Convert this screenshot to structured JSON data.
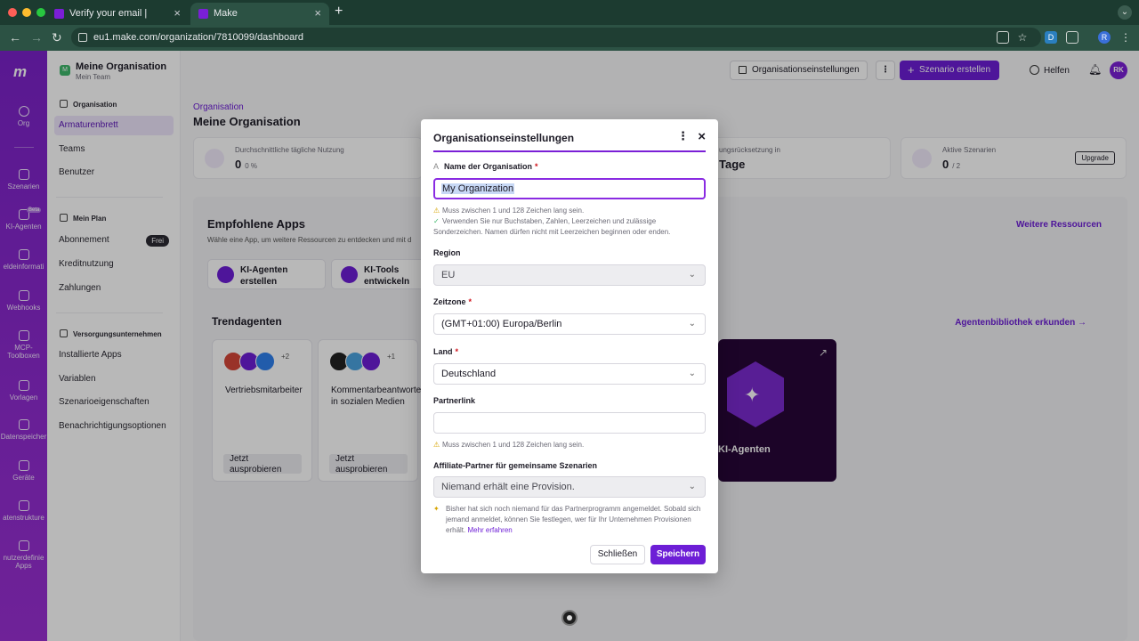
{
  "browser": {
    "tabs": [
      {
        "title": "Verify your email |"
      },
      {
        "title": "Make"
      }
    ],
    "url": "eu1.make.com/organization/7810099/dashboard",
    "ext_labels": [
      "D",
      "R"
    ]
  },
  "rail": {
    "logo": "m",
    "items": [
      "Org",
      "Szenarien",
      "KI-Agenten",
      "eldeinformati",
      "Webhooks",
      "MCP-Toolboxen",
      "Vorlagen",
      "Datenspeicher",
      "Geräte",
      "atenstrukture",
      "nutzerdefinie Apps"
    ],
    "beta": "Beta"
  },
  "sidebar": {
    "org_initial": "M",
    "org_name": "Meine Organisation",
    "team": "Mein Team",
    "section_org": "Organisation",
    "items_org": [
      "Armaturenbrett",
      "Teams",
      "Benutzer"
    ],
    "section_plan": "Mein Plan",
    "items_plan": [
      "Abonnement",
      "Kreditnutzung",
      "Zahlungen"
    ],
    "plan_badge": "Frei",
    "section_supply": "Versorgungsunternehmen",
    "items_supply": [
      "Installierte Apps",
      "Variablen",
      "Szenarioeigenschaften",
      "Benachrichtigungsoptionen"
    ]
  },
  "topbar": {
    "settings_button": "Organisationseinstellungen",
    "create_button": "Szenario erstellen",
    "help": "Helfen",
    "avatar": "RK"
  },
  "main": {
    "crumb": "Organisation",
    "title": "Meine Organisation",
    "stats": [
      {
        "label": "Durchschnittliche tägliche Nutzung",
        "value": "0",
        "sub": "0 %"
      },
      {
        "label": "ungsrücksetzung in",
        "value": "Tage",
        "sub": ""
      },
      {
        "label": "Aktive Szenarien",
        "value": "0",
        "sub": "/ 2",
        "action": "Upgrade"
      }
    ],
    "recommended_title": "Empfohlene Apps",
    "recommended_sub": "Wähle eine App, um weitere Ressourcen zu entdecken und mit d",
    "more_resources": "Weitere Ressourcen",
    "app_cards": [
      "KI-Agenten erstellen",
      "KI-Tools entwickeln"
    ],
    "trend_title": "Trendagenten",
    "trend_link": "Agentenbibliothek erkunden →",
    "agents": [
      {
        "name": "Vertriebsmitarbeiter",
        "more": "+2",
        "try": "Jetzt ausprobieren"
      },
      {
        "name": "Kommentarbeantworter in sozialen Medien",
        "more": "+1",
        "try": "Jetzt ausprobieren"
      }
    ],
    "promo_label": "KI-Agenten"
  },
  "modal": {
    "title": "Organisationseinstellungen",
    "name_label": "Name der Organisation",
    "name_prefix": "A",
    "name_value": "My Organization",
    "name_hint1": "Muss zwischen 1 und 128 Zeichen lang sein.",
    "name_hint2": "Verwenden Sie nur Buchstaben, Zahlen, Leerzeichen und zulässige Sonderzeichen. Namen dürfen nicht mit Leerzeichen beginnen oder enden.",
    "region_label": "Region",
    "region_value": "EU",
    "timezone_label": "Zeitzone",
    "timezone_value": "(GMT+01:00) Europa/Berlin",
    "country_label": "Land",
    "country_value": "Deutschland",
    "partner_label": "Partnerlink",
    "partner_value": "",
    "partner_hint": "Muss zwischen 1 und 128 Zeichen lang sein.",
    "affiliate_label": "Affiliate-Partner für gemeinsame Szenarien",
    "affiliate_value": "Niemand erhält eine Provision.",
    "affiliate_hint": "Bisher hat sich noch niemand für das Partnerprogramm angemeldet. Sobald sich jemand anmeldet, können Sie festlegen, wer für Ihr Unternehmen Provisionen erhält.",
    "more_link": "Mehr erfahren",
    "close_button": "Schließen",
    "save_button": "Speichern"
  },
  "colors": {
    "accent": "#6d1ed6",
    "focus": "#8a2be2",
    "rail": "#7b22c9"
  }
}
